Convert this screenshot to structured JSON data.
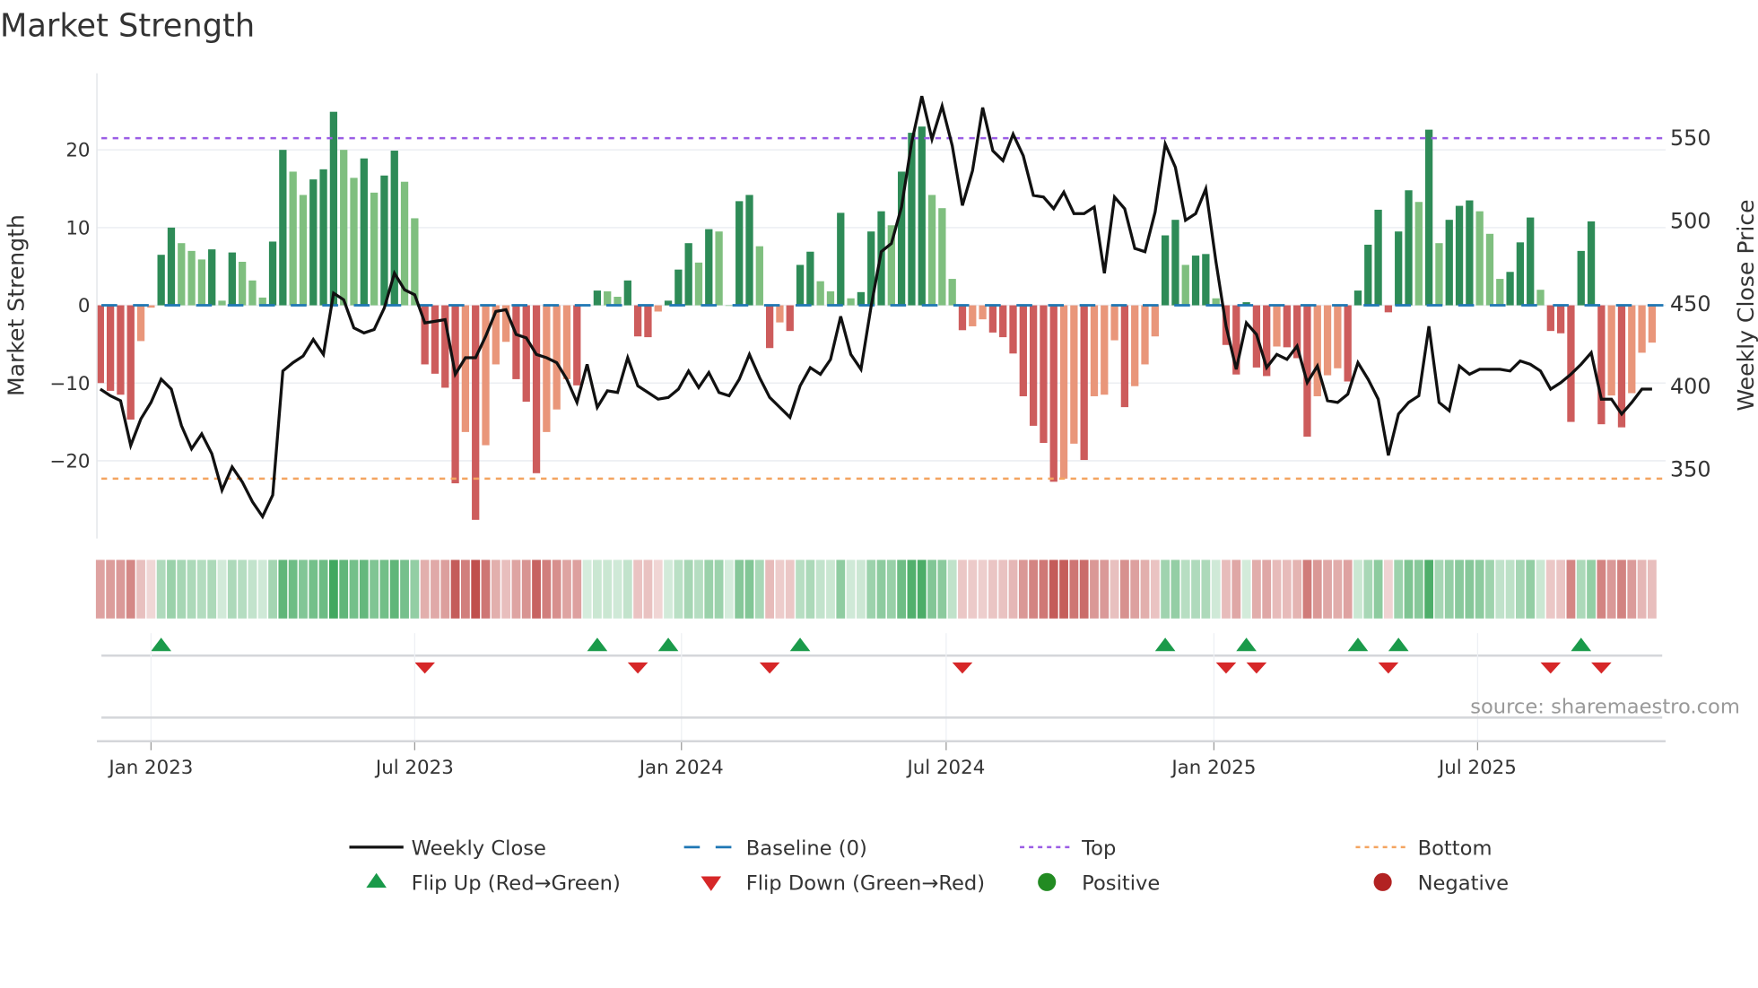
{
  "title": "Market Strength",
  "source": "source: sharemaestro.com",
  "colors": {
    "pos_dark": "#2e8b57",
    "pos_light": "#7fbf7f",
    "neg_dark": "#cd5c5c",
    "neg_light": "#e9967a",
    "baseline": "#1f77b4",
    "top": "#9b5de5",
    "bottom": "#f4a460",
    "line": "#111111",
    "flip_up": "#1a9a4a",
    "flip_down": "#d62728",
    "positive": "#228b22",
    "negative": "#b22222"
  },
  "chart_data": {
    "type": "bar+line",
    "title": "Market Strength",
    "ylabel_left": "Market Strength",
    "ylabel_right": "Weekly Close Price",
    "ylim_left": [
      -30,
      29
    ],
    "ylim_right": [
      310,
      580
    ],
    "left_ticks": [
      {
        "v": 20,
        "label": "20"
      },
      {
        "v": 10,
        "label": "10"
      },
      {
        "v": 0,
        "label": "0"
      },
      {
        "v": -10,
        "label": "−10"
      },
      {
        "v": -20,
        "label": "−20"
      }
    ],
    "right_ticks": [
      {
        "v": 550,
        "label": "550"
      },
      {
        "v": 500,
        "label": "500"
      },
      {
        "v": 450,
        "label": "450"
      },
      {
        "v": 400,
        "label": "400"
      },
      {
        "v": 350,
        "label": "350"
      }
    ],
    "x_ticks": [
      {
        "week": 5,
        "label": "Jan 2023"
      },
      {
        "week": 31,
        "label": "Jul 2023"
      },
      {
        "week": 57.3,
        "label": "Jan 2024"
      },
      {
        "week": 83.4,
        "label": "Jul 2024"
      },
      {
        "week": 109.8,
        "label": "Jan 2025"
      },
      {
        "week": 135.8,
        "label": "Jul 2025"
      }
    ],
    "top_level": 21.5,
    "bottom_level": -22.3,
    "baseline": 0,
    "strength": [
      -10,
      -11,
      -11.5,
      -14.7,
      -4.6,
      -0.3,
      6.5,
      10,
      8,
      7,
      5.9,
      7.2,
      0.6,
      6.8,
      5.6,
      3.2,
      1,
      8.2,
      20,
      17.2,
      14.2,
      16.2,
      17.5,
      24.9,
      20,
      16.4,
      18.9,
      14.5,
      16.7,
      19.9,
      15.9,
      11.2,
      -7.6,
      -8.8,
      -10.6,
      -22.9,
      -16.3,
      -27.6,
      -18,
      -7.6,
      -4.7,
      -9.5,
      -12.4,
      -21.6,
      -16.3,
      -13.4,
      -9.5,
      -10.3,
      0,
      1.9,
      1.8,
      1.1,
      3.2,
      -4,
      -4.1,
      -0.8,
      0.6,
      4.6,
      8,
      5.5,
      9.8,
      9.5,
      0,
      13.4,
      14.2,
      7.6,
      -5.5,
      -2.2,
      -3.3,
      5.2,
      6.9,
      3.1,
      1.8,
      11.9,
      0.9,
      1.7,
      9.5,
      12.1,
      10.3,
      17.2,
      22.2,
      23,
      14.2,
      12.5,
      3.4,
      -3.2,
      -2.7,
      -1.8,
      -3.5,
      -4.1,
      -6.2,
      -11.7,
      -15.5,
      -17.7,
      -22.7,
      -22.3,
      -17.8,
      -19.9,
      -11.7,
      -11.5,
      -4.5,
      -13.1,
      -10.4,
      -7.6,
      -4,
      9,
      11,
      5.2,
      6.4,
      6.6,
      0.9,
      -5.1,
      -8.9,
      0.4,
      -8,
      -9.1,
      -5.3,
      -5.4,
      -6.8,
      -16.9,
      -11.7,
      -9,
      -8.1,
      -9.8,
      1.9,
      7.8,
      12.3,
      -0.9,
      9.5,
      14.8,
      13.3,
      22.6,
      8,
      11,
      12.8,
      13.5,
      12.1,
      9.2,
      3.4,
      4.3,
      8.1,
      11.3,
      2,
      -3.3,
      -3.6,
      -15,
      7,
      10.8,
      -15.3,
      -11.6,
      -15.7,
      -11.3,
      -6.1,
      -4.8
    ],
    "weekly_close": [
      398,
      394,
      391,
      364,
      380,
      390,
      404,
      398,
      376,
      362,
      371,
      359,
      337,
      351,
      342,
      330,
      321,
      334,
      409,
      414,
      418,
      428,
      419,
      456,
      452,
      435,
      432,
      434,
      447,
      468,
      458,
      455,
      438,
      439,
      440,
      407,
      417,
      417,
      430,
      445,
      446,
      431,
      429,
      419,
      417,
      414,
      404,
      390,
      413,
      387,
      397,
      396,
      417,
      400,
      396,
      392,
      393,
      398,
      409,
      399,
      408,
      396,
      394,
      404,
      419,
      405,
      393,
      387,
      381,
      400,
      411,
      407,
      416,
      442,
      419,
      410,
      448,
      481,
      486,
      508,
      547,
      575,
      549,
      569,
      545,
      509,
      530,
      568,
      542,
      536,
      552,
      539,
      515,
      514,
      507,
      517,
      504,
      504,
      508,
      468,
      514,
      507,
      483,
      481,
      505,
      546,
      532,
      500,
      504,
      519,
      475,
      436,
      410,
      438,
      431,
      411,
      419,
      416,
      424,
      402,
      412,
      391,
      390,
      395,
      414,
      404,
      392,
      358,
      383,
      390,
      394,
      436,
      390,
      385,
      412,
      407,
      410,
      410,
      410,
      409,
      415,
      413,
      409,
      398,
      402,
      407,
      413,
      420,
      392,
      392,
      383,
      390,
      398,
      398
    ]
  },
  "legend": [
    {
      "key": "line",
      "label": "Weekly Close"
    },
    {
      "key": "baseline",
      "label": "Baseline (0)"
    },
    {
      "key": "top",
      "label": "Top"
    },
    {
      "key": "bottom",
      "label": "Bottom"
    },
    {
      "key": "flip_up",
      "label": "Flip Up (Red→Green)"
    },
    {
      "key": "flip_down",
      "label": "Flip Down (Green→Red)"
    },
    {
      "key": "positive",
      "label": "Positive"
    },
    {
      "key": "negative",
      "label": "Negative"
    }
  ]
}
